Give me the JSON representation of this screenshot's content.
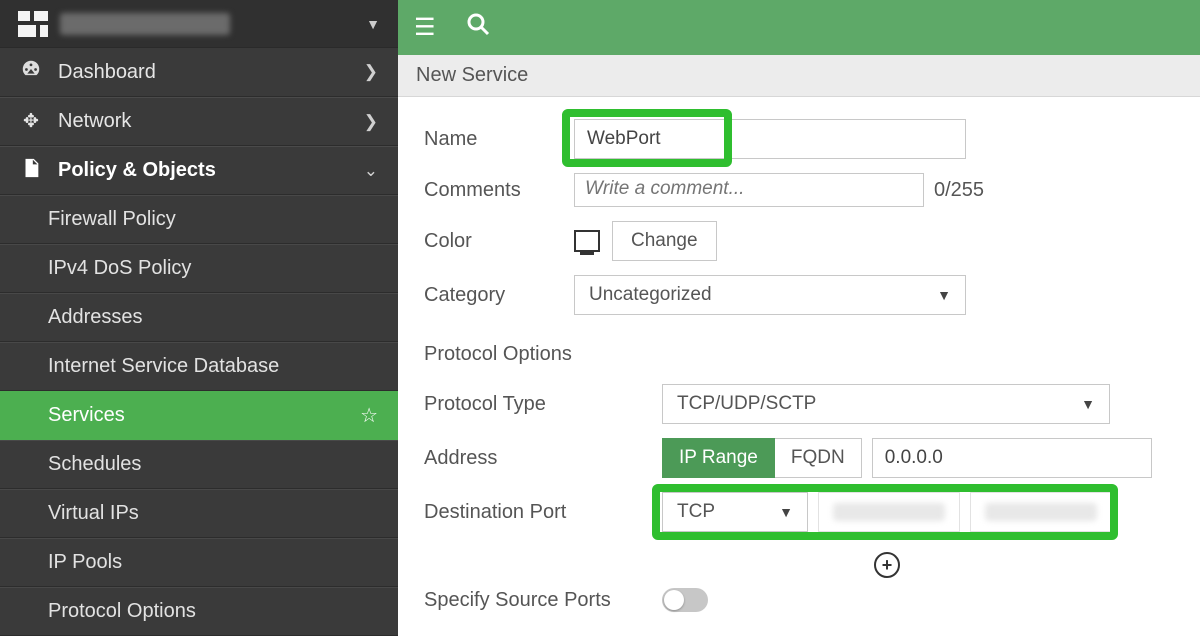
{
  "sidebar": {
    "nav": [
      {
        "label": "Dashboard",
        "icon": "gauge-icon"
      },
      {
        "label": "Network",
        "icon": "move-icon"
      },
      {
        "label": "Policy & Objects",
        "icon": "document-icon"
      }
    ],
    "sub": [
      {
        "label": "Firewall Policy"
      },
      {
        "label": "IPv4 DoS Policy"
      },
      {
        "label": "Addresses"
      },
      {
        "label": "Internet Service Database"
      },
      {
        "label": "Services"
      },
      {
        "label": "Schedules"
      },
      {
        "label": "Virtual IPs"
      },
      {
        "label": "IP Pools"
      },
      {
        "label": "Protocol Options"
      }
    ]
  },
  "page": {
    "title": "New Service"
  },
  "form": {
    "name_label": "Name",
    "name_value": "WebPort",
    "comments_label": "Comments",
    "comments_placeholder": "Write a comment...",
    "comments_counter": "0/255",
    "color_label": "Color",
    "change_btn": "Change",
    "category_label": "Category",
    "category_value": "Uncategorized"
  },
  "protocol": {
    "section": "Protocol Options",
    "type_label": "Protocol Type",
    "type_value": "TCP/UDP/SCTP",
    "address_label": "Address",
    "toggle_iprange": "IP Range",
    "toggle_fqdn": "FQDN",
    "ip_value": "0.0.0.0",
    "dest_label": "Destination Port",
    "dest_proto": "TCP",
    "specify_label": "Specify Source Ports"
  }
}
